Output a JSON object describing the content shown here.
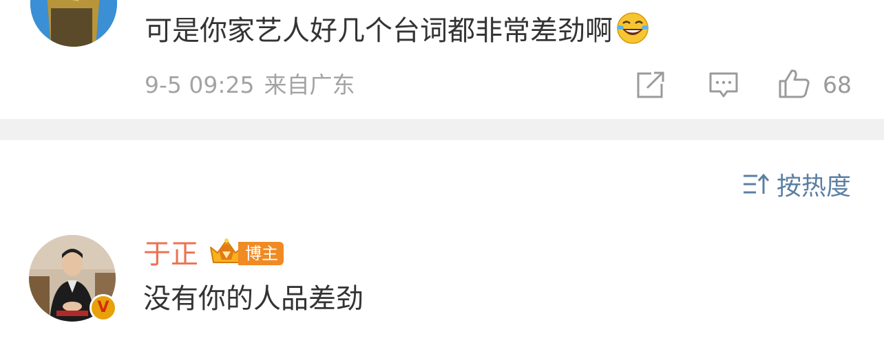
{
  "comment_1": {
    "text": "可是你家艺人好几个台词都非常差劲啊",
    "emoji": "laugh-cry-emoji",
    "date": "9-5 09:25",
    "location": "来自广东",
    "like_count": "68"
  },
  "sort": {
    "label": "按热度"
  },
  "comment_2": {
    "username": "于正",
    "badge_label": "博主",
    "verified_mark": "V",
    "text": "没有你的人品差劲"
  },
  "colors": {
    "username": "#eb7350",
    "sort_link": "#5b7fa3",
    "badge": "#f08a24",
    "meta_text": "#a3a3a3",
    "divider": "#f1f1f1"
  }
}
